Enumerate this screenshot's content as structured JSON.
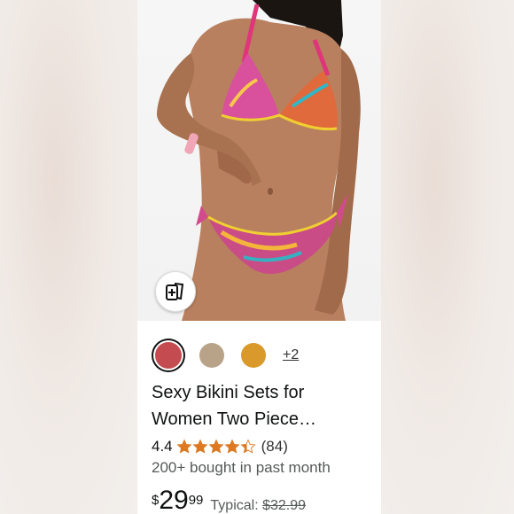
{
  "product": {
    "swatches": [
      {
        "color": "#c44b4f",
        "selected": true
      },
      {
        "color": "#b8a389",
        "selected": false
      },
      {
        "color": "#d99a2b",
        "selected": false
      }
    ],
    "more_colors": "+2",
    "title_line1": "Sexy Bikini Sets for",
    "title_line2": "Women Two Piece…",
    "rating": "4.4",
    "rating_stars": 4.4,
    "review_count": "(84)",
    "bought": "200+ bought in past month",
    "price_symbol": "$",
    "price_whole": "29",
    "price_fraction": "99",
    "typical_label": "Typical:",
    "typical_price": "$32.99"
  },
  "colors": {
    "star": "#de7921",
    "text": "#0f1111",
    "muted": "#565959"
  }
}
